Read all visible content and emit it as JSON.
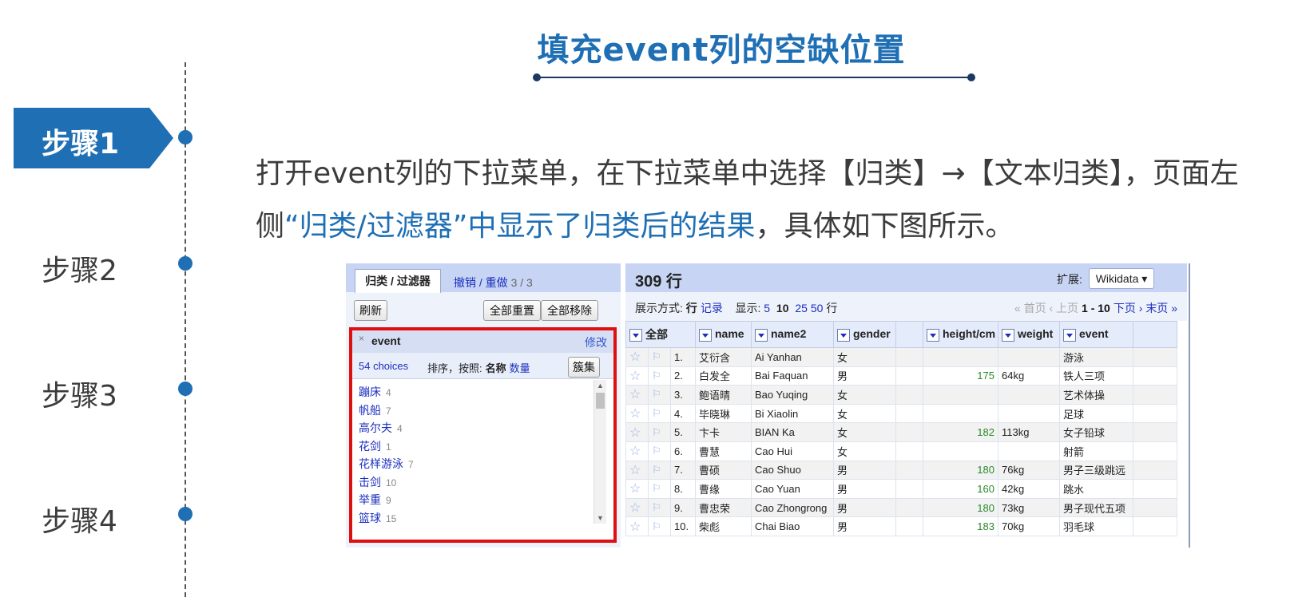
{
  "slide": {
    "title": "填充event列的空缺位置",
    "steps": [
      "步骤1",
      "步骤2",
      "步骤3",
      "步骤4"
    ],
    "description_part1": "打开event列的下拉菜单，在下拉菜单中选择【归类】→【文本归类】，页面左侧",
    "description_highlight": "“归类/过滤器”中显示了归类后的结果",
    "description_part2": "，具体如下图所示。"
  },
  "app": {
    "left_panel": {
      "tab_active": "归类 / 过滤器",
      "tab_undo": "撤销 / 重做",
      "tab_undo_count": "3 / 3",
      "refresh": "刷新",
      "reset_all": "全部重置",
      "remove_all": "全部移除",
      "facet": {
        "close": "×",
        "name": "event",
        "edit": "修改",
        "choices": "54 choices",
        "sort_label": "排序，按照:",
        "sort_name": "名称",
        "sort_count": "数量",
        "cluster": "簇集",
        "items": [
          {
            "name": "蹦床",
            "count": "4"
          },
          {
            "name": "帆船",
            "count": "7"
          },
          {
            "name": "高尔夫",
            "count": "4"
          },
          {
            "name": "花剑",
            "count": "1"
          },
          {
            "name": "花样游泳",
            "count": "7"
          },
          {
            "name": "击剑",
            "count": "10"
          },
          {
            "name": "举重",
            "count": "9"
          },
          {
            "name": "篮球",
            "count": "15"
          }
        ]
      }
    },
    "right_panel": {
      "rows": "309 行",
      "ext_label": "扩展:",
      "ext_value": "Wikidata ▾",
      "view_as": "展示方式:",
      "view_row": "行",
      "view_record": "记录",
      "show_label": "显示:",
      "show_opts": [
        "5",
        "10",
        "25",
        "50"
      ],
      "show_suffix": "行",
      "pager_first": "« 首页",
      "pager_prev": "‹ 上页",
      "pager_range": "1 - 10",
      "pager_next": "下页 ›",
      "pager_last": "末页 »",
      "columns": [
        "全部",
        "name",
        "name2",
        "gender",
        "height/cm",
        "weight",
        "event"
      ],
      "rows_data": [
        {
          "idx": "1.",
          "name": "艾衍含",
          "name2": "Ai Yanhan",
          "gender": "女",
          "height": "",
          "weight": "",
          "event": "游泳"
        },
        {
          "idx": "2.",
          "name": "白发全",
          "name2": "Bai Faquan",
          "gender": "男",
          "height": "175",
          "weight": "64kg",
          "event": "铁人三项"
        },
        {
          "idx": "3.",
          "name": "鲍语晴",
          "name2": "Bao Yuqing",
          "gender": "女",
          "height": "",
          "weight": "",
          "event": "艺术体操"
        },
        {
          "idx": "4.",
          "name": "毕晓琳",
          "name2": "Bi Xiaolin",
          "gender": "女",
          "height": "",
          "weight": "",
          "event": "足球"
        },
        {
          "idx": "5.",
          "name": "卞卡",
          "name2": "BIAN Ka",
          "gender": "女",
          "height": "182",
          "weight": "113kg",
          "event": "女子铅球"
        },
        {
          "idx": "6.",
          "name": "曹慧",
          "name2": "Cao Hui",
          "gender": "女",
          "height": "",
          "weight": "",
          "event": "射箭"
        },
        {
          "idx": "7.",
          "name": "曹硕",
          "name2": "Cao Shuo",
          "gender": "男",
          "height": "180",
          "weight": "76kg",
          "event": "男子三级跳远"
        },
        {
          "idx": "8.",
          "name": "曹缘",
          "name2": "Cao Yuan",
          "gender": "男",
          "height": "160",
          "weight": "42kg",
          "event": "跳水"
        },
        {
          "idx": "9.",
          "name": "曹忠荣",
          "name2": "Cao Zhongrong",
          "gender": "男",
          "height": "180",
          "weight": "73kg",
          "event": "男子现代五项"
        },
        {
          "idx": "10.",
          "name": "柴彪",
          "name2": "Chai Biao",
          "gender": "男",
          "height": "183",
          "weight": "70kg",
          "event": "羽毛球"
        }
      ]
    }
  }
}
